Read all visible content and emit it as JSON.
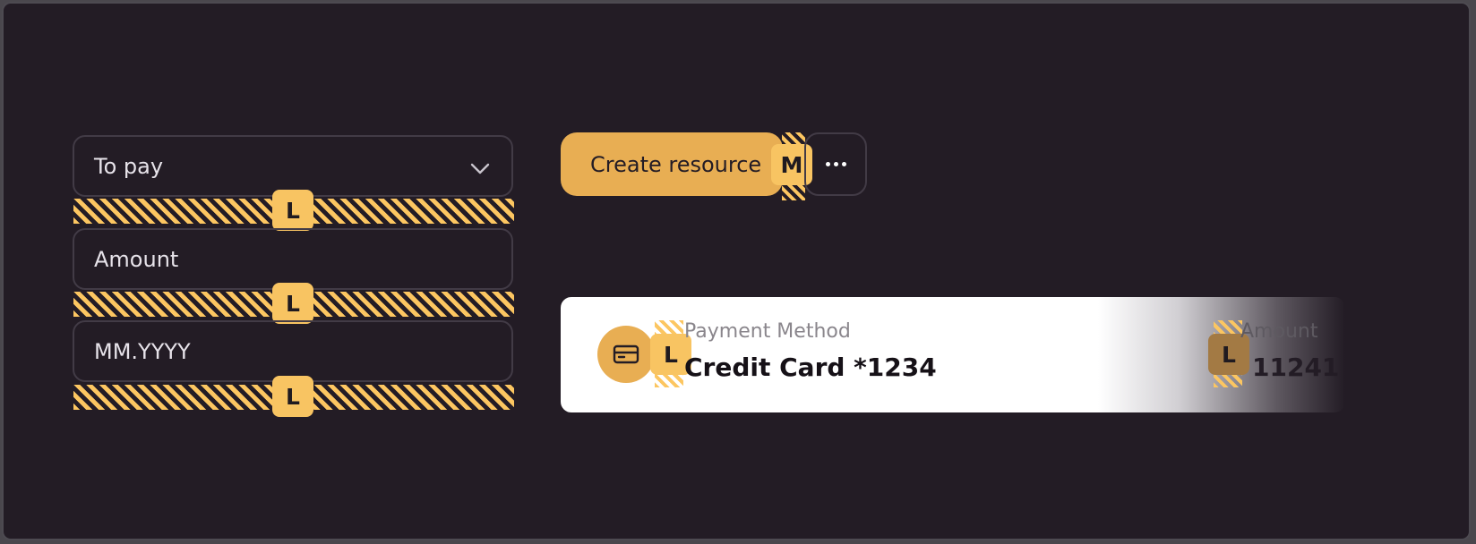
{
  "form": {
    "select_value": "To pay",
    "amount_placeholder": "Amount",
    "date_placeholder": "MM.YYYY",
    "gap_badges": [
      "L",
      "L",
      "L"
    ]
  },
  "actions": {
    "create_label": "Create resource",
    "gap_badge": "M",
    "more_icon": "more-horizontal-icon"
  },
  "payment_card": {
    "icon": "credit-card-icon",
    "gap_badge_left": "L",
    "gap_badge_right": "L",
    "method_caption": "Payment Method",
    "method_value": "Credit Card *1234",
    "amount_caption": "Amount",
    "amount_value": "11241"
  },
  "colors": {
    "background": "#231c25",
    "accent": "#e8ae53",
    "badge": "#f8c462",
    "border": "#423b46"
  }
}
